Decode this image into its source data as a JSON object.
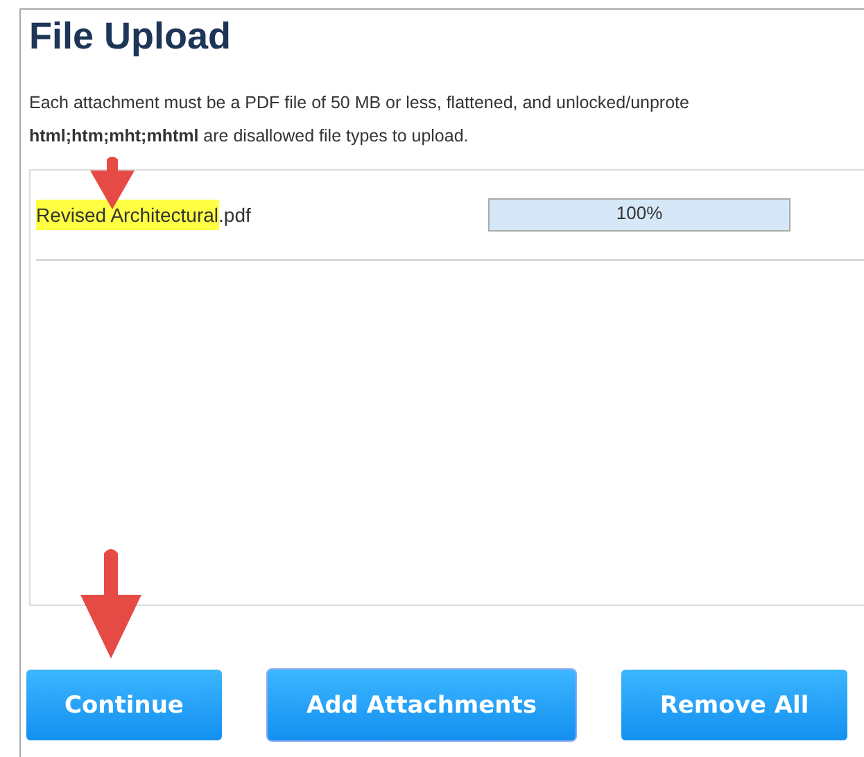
{
  "title": "File Upload",
  "description": "Each attachment must be a PDF file of 50 MB or less, flattened, and unlocked/unprote\n**html;htm;mht;mhtml** are disallowed file types to upload.",
  "files": [
    {
      "name": "Revised Architectural",
      "extension": ".pdf",
      "highlighted": true,
      "level": 1,
      "reading": "100%"
    }
  ],
  "buttons": [
    {
      "label": "Continue",
      "kind": "continue"
    },
    {
      "label": "Add Attachments",
      "kind": "add"
    },
    {
      "label": "Remove All",
      "kind": "remove"
    }
  ]
}
